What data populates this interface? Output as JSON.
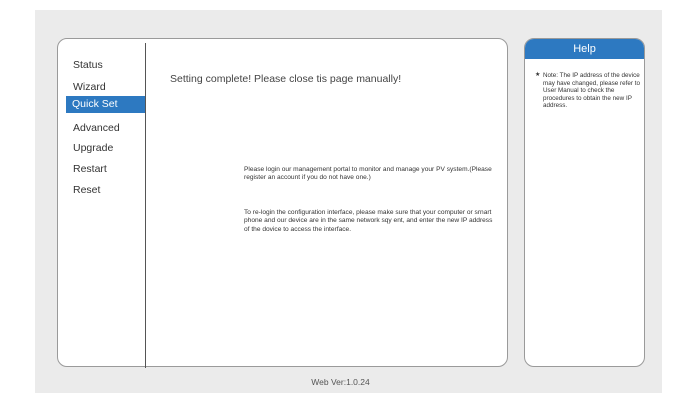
{
  "nav": {
    "items": [
      {
        "label": "Status"
      },
      {
        "label": "Wizard"
      },
      {
        "label": "Quick Set"
      },
      {
        "label": "Advanced"
      },
      {
        "label": "Upgrade"
      },
      {
        "label": "Restart"
      },
      {
        "label": "Reset"
      }
    ],
    "active_index": 2
  },
  "main": {
    "headline": "Setting complete! Please close tis page manually!",
    "paragraph1": "Please login our management portal to monitor and manage your PV system.(Please register an account if you do not have one.)",
    "paragraph2": "To re-login the configuration interface, please make sure that your computer or srnart phone and our device are in the same network sqy ent, and enter the new IP address of the dovice to access the interface."
  },
  "help": {
    "title": "Help",
    "star": "★",
    "note": "Note: The IP address of the device may have changed, please refer to User Manual to check the procedures to obtain the new IP address."
  },
  "footer": {
    "version": "Web Ver:1.0.24"
  },
  "colors": {
    "accent": "#2d79c1",
    "background": "#ebebeb"
  }
}
